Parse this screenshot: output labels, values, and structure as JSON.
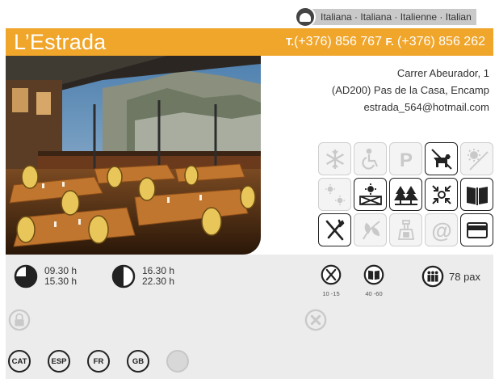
{
  "cuisine": {
    "icon": "chef-hat-icon",
    "text": "Italiana · Italiana · Italienne · Italian"
  },
  "header": {
    "title": "L’Estrada",
    "phone_prefix": "T.",
    "phone": "(+376) 856 767",
    "fax_prefix": "F.",
    "fax": "(+376) 856 262",
    "accent_color": "#f0a52b"
  },
  "address": {
    "line1": "Carrer Abeurador, 1",
    "line2": "(AD200) Pas de la Casa, Encamp",
    "email": "estrada_564@hotmail.com"
  },
  "amenities": [
    {
      "icon": "air-conditioning-icon",
      "active": false
    },
    {
      "icon": "wheelchair-access-icon",
      "active": false
    },
    {
      "icon": "parking-icon",
      "active": false
    },
    {
      "icon": "pets-allowed-icon",
      "active": true
    },
    {
      "icon": "no-smoking-terrace-icon",
      "active": false
    },
    {
      "icon": "sun-terrace-icon",
      "active": false
    },
    {
      "icon": "terrace-icon",
      "active": true
    },
    {
      "icon": "mountain-view-icon",
      "active": true
    },
    {
      "icon": "central-location-icon",
      "active": true
    },
    {
      "icon": "menu-book-icon",
      "active": true
    },
    {
      "icon": "restaurant-icon",
      "active": true
    },
    {
      "icon": "vegetarian-icon",
      "active": false
    },
    {
      "icon": "takeaway-icon",
      "active": false
    },
    {
      "icon": "email-icon",
      "active": false
    },
    {
      "icon": "credit-card-icon",
      "active": true
    }
  ],
  "hours": [
    {
      "open": "09.30 h",
      "close": "15.30 h"
    },
    {
      "open": "16.30 h",
      "close": "22.30 h"
    }
  ],
  "prices": [
    {
      "icon": "menu-price-icon",
      "range": "10 -15 "
    },
    {
      "icon": "a-la-carte-price-icon",
      "range": "40 -60 "
    }
  ],
  "capacity": {
    "icon": "people-icon",
    "value": "78 pax"
  },
  "status": {
    "lock_icon": "lock-icon",
    "closed_icon": "closed-day-icon"
  },
  "languages": [
    {
      "code": "CAT",
      "active": true
    },
    {
      "code": "ESP",
      "active": true
    },
    {
      "code": "FR",
      "active": true
    },
    {
      "code": "GB",
      "active": true
    },
    {
      "code": "",
      "active": false
    }
  ]
}
